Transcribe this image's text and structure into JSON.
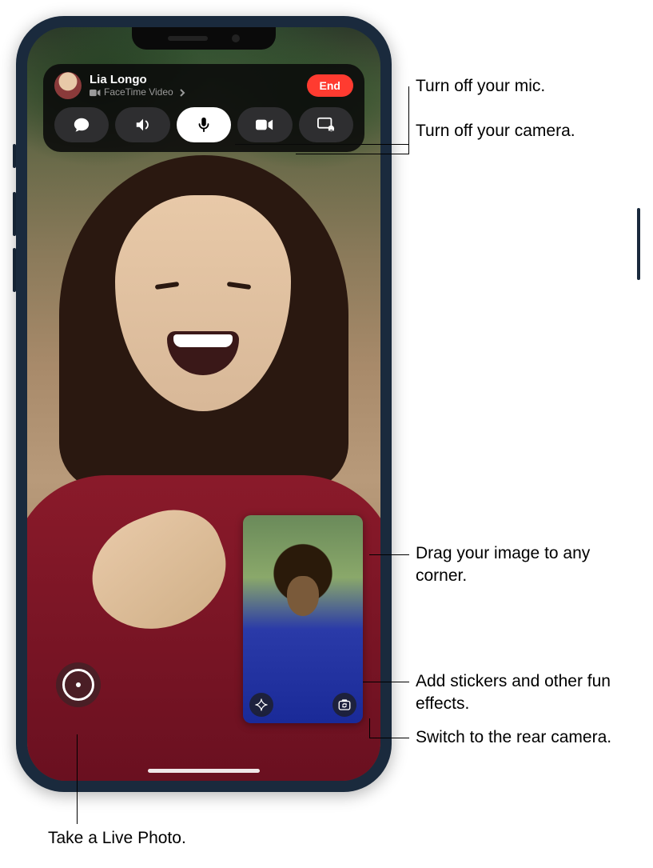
{
  "banner": {
    "caller_name": "Lia Longo",
    "call_type_label": "FaceTime Video",
    "end_label": "End"
  },
  "controls": {
    "messages": "messages",
    "speaker": "speaker",
    "mic": "mute",
    "camera": "camera",
    "share": "screen-share"
  },
  "pip": {
    "effects": "effects",
    "flip": "flip-camera"
  },
  "callouts": {
    "mic": "Turn off your mic.",
    "camera": "Turn off your camera.",
    "pip_drag": "Drag your image to any corner.",
    "effects": "Add stickers and other fun effects.",
    "flip": "Switch to the rear camera.",
    "shutter": "Take a Live Photo."
  }
}
